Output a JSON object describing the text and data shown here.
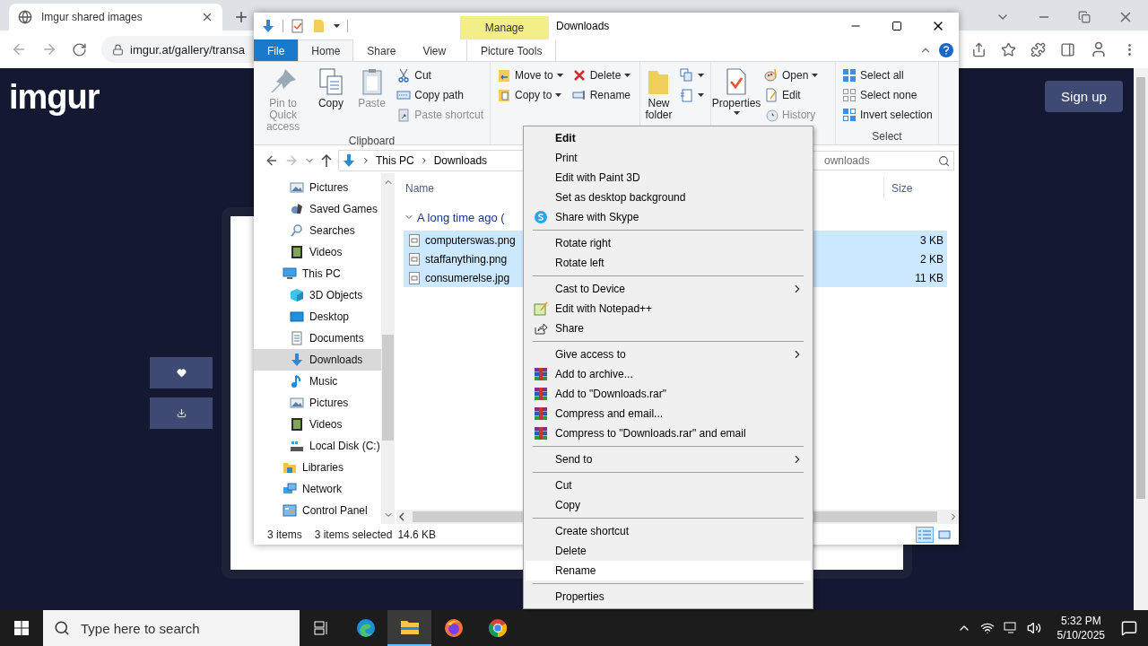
{
  "browser": {
    "tab": {
      "title": "Imgur shared images",
      "selected": true
    },
    "url": "imgur.at/gallery/transa"
  },
  "page": {
    "logo": "imgur",
    "signup": "Sign up"
  },
  "explorer": {
    "title": "Downloads",
    "context_tab": "Manage",
    "tabs": [
      {
        "label": "File",
        "kind": "file",
        "selected": false
      },
      {
        "label": "Home",
        "kind": "plain",
        "selected": true
      },
      {
        "label": "Share",
        "kind": "plain",
        "selected": false
      },
      {
        "label": "View",
        "kind": "plain",
        "selected": false
      },
      {
        "label": "Picture Tools",
        "kind": "context",
        "selected": false
      }
    ],
    "ribbon": [
      {
        "label": "Clipboard",
        "columns": [
          {
            "kind": "large",
            "buttons": [
              {
                "kind": "pin",
                "label": "Pin to Quick access",
                "disabled": true,
                "dropdown": false
              }
            ]
          },
          {
            "kind": "large",
            "buttons": [
              {
                "kind": "copy",
                "label": "Copy",
                "disabled": false,
                "dropdown": false
              }
            ]
          },
          {
            "kind": "large",
            "buttons": [
              {
                "kind": "paste",
                "label": "Paste",
                "disabled": true,
                "dropdown": false
              }
            ]
          },
          {
            "kind": "small",
            "buttons": [
              {
                "kind": "cut",
                "label": "Cut",
                "disabled": false,
                "dropdown": false
              },
              {
                "kind": "copypath",
                "label": "Copy path",
                "disabled": false,
                "dropdown": false
              },
              {
                "kind": "pasteshortcut",
                "label": "Paste shortcut",
                "disabled": true,
                "dropdown": false
              }
            ]
          }
        ]
      },
      {
        "columns": [
          {
            "kind": "small",
            "buttons": [
              {
                "kind": "moveto",
                "label": "Move to",
                "disabled": false,
                "dropdown": true
              },
              {
                "kind": "copyto",
                "label": "Copy to",
                "disabled": false,
                "dropdown": true
              }
            ]
          },
          {
            "kind": "small",
            "buttons": [
              {
                "kind": "delete",
                "label": "Delete",
                "disabled": false,
                "dropdown": true
              },
              {
                "kind": "rename",
                "label": "Rename",
                "disabled": false,
                "dropdown": false
              }
            ]
          }
        ]
      },
      {
        "columns": [
          {
            "kind": "large",
            "buttons": [
              {
                "kind": "newfolder",
                "label": "New folder",
                "disabled": false,
                "dropdown": false
              }
            ]
          },
          {
            "kind": "small",
            "buttons": [
              {
                "kind": "newitem",
                "dropdown": true
              },
              {
                "kind": "easyaccess",
                "dropdown": true
              }
            ]
          }
        ]
      },
      {
        "columns": [
          {
            "kind": "large",
            "buttons": [
              {
                "kind": "properties",
                "label": "Properties",
                "disabled": false,
                "dropdown": true
              }
            ]
          },
          {
            "kind": "small",
            "buttons": [
              {
                "kind": "open",
                "label": "Open",
                "disabled": false,
                "dropdown": true
              },
              {
                "kind": "edit",
                "label": "Edit",
                "disabled": false,
                "dropdown": false
              },
              {
                "kind": "history",
                "label": "History",
                "disabled": true,
                "dropdown": false
              }
            ]
          }
        ]
      },
      {
        "label": "Select",
        "columns": [
          {
            "kind": "small",
            "buttons": [
              {
                "kind": "selectall",
                "label": "Select all",
                "disabled": false,
                "dropdown": false
              },
              {
                "kind": "selectnone",
                "label": "Select none",
                "disabled": false,
                "dropdown": false
              },
              {
                "kind": "invert",
                "label": "Invert selection",
                "disabled": false,
                "dropdown": false
              }
            ]
          }
        ]
      }
    ],
    "breadcrumb": [
      "This PC",
      "Downloads"
    ],
    "search": {
      "placeholder": "ownloads"
    },
    "sidebar": {
      "partial_children": [
        {
          "label": "Pictures",
          "kind": "pictures",
          "selected": false
        },
        {
          "label": "Saved Games",
          "kind": "games",
          "selected": false
        },
        {
          "label": "Searches",
          "kind": "search",
          "selected": false
        },
        {
          "label": "Videos",
          "kind": "videos",
          "selected": false
        }
      ],
      "items": [
        {
          "label": "This PC",
          "kind": "pc",
          "selected": false,
          "children": [
            {
              "label": "3D Objects",
              "kind": "objects",
              "selected": false
            },
            {
              "label": "Desktop",
              "kind": "desktop",
              "selected": false
            },
            {
              "label": "Documents",
              "kind": "documents",
              "selected": false
            },
            {
              "label": "Downloads",
              "kind": "downloads",
              "selected": true
            },
            {
              "label": "Music",
              "kind": "music",
              "selected": false
            },
            {
              "label": "Pictures",
              "kind": "pictures",
              "selected": false
            },
            {
              "label": "Videos",
              "kind": "videos",
              "selected": false
            },
            {
              "label": "Local Disk (C:)",
              "kind": "disk",
              "selected": false
            }
          ]
        },
        {
          "label": "Libraries",
          "kind": "libraries",
          "selected": false
        },
        {
          "label": "Network",
          "kind": "network",
          "selected": false
        },
        {
          "label": "Control Panel",
          "kind": "control",
          "selected": false
        }
      ]
    },
    "columns": [
      "Name",
      "Size"
    ],
    "group": "A long time ago (",
    "files": [
      {
        "name": "computerswas.png",
        "size": "3 KB",
        "selected": true
      },
      {
        "name": "staffanything.png",
        "size": "2 KB",
        "selected": true
      },
      {
        "name": "consumerelse.jpg",
        "size": "11 KB",
        "selected": true
      }
    ],
    "status": {
      "count": "3 items",
      "selected": "3 items selected",
      "size": "14.6 KB"
    }
  },
  "context_menu": [
    [
      {
        "label": "Edit",
        "kind": "plain",
        "default": true,
        "selected": false,
        "submenu": false
      },
      {
        "label": "Print",
        "kind": "plain",
        "default": false,
        "selected": false,
        "submenu": false
      },
      {
        "label": "Edit with Paint 3D",
        "kind": "plain",
        "default": false,
        "selected": false,
        "submenu": false
      },
      {
        "label": "Set as desktop background",
        "kind": "plain",
        "default": false,
        "selected": false,
        "submenu": false
      },
      {
        "label": "Share with Skype",
        "kind": "skype",
        "default": false,
        "selected": false,
        "submenu": false
      }
    ],
    [
      {
        "label": "Rotate right",
        "kind": "plain",
        "default": false,
        "selected": false,
        "submenu": false
      },
      {
        "label": "Rotate left",
        "kind": "plain",
        "default": false,
        "selected": false,
        "submenu": false
      }
    ],
    [
      {
        "label": "Cast to Device",
        "kind": "plain",
        "default": false,
        "selected": false,
        "submenu": true
      },
      {
        "label": "Edit with Notepad++",
        "kind": "notepad",
        "default": false,
        "selected": false,
        "submenu": false
      },
      {
        "label": "Share",
        "kind": "share",
        "default": false,
        "selected": false,
        "submenu": false
      }
    ],
    [
      {
        "label": "Give access to",
        "kind": "plain",
        "default": false,
        "selected": false,
        "submenu": true
      },
      {
        "label": "Add to archive...",
        "kind": "archive",
        "default": false,
        "selected": false,
        "submenu": false
      },
      {
        "label": "Add to \"Downloads.rar\"",
        "kind": "archive",
        "default": false,
        "selected": false,
        "submenu": false
      },
      {
        "label": "Compress and email...",
        "kind": "archive",
        "default": false,
        "selected": false,
        "submenu": false
      },
      {
        "label": "Compress to \"Downloads.rar\" and email",
        "kind": "archive",
        "default": false,
        "selected": false,
        "submenu": false
      }
    ],
    [
      {
        "label": "Send to",
        "kind": "plain",
        "default": false,
        "selected": false,
        "submenu": true
      }
    ],
    [
      {
        "label": "Cut",
        "kind": "plain",
        "default": false,
        "selected": false,
        "submenu": false
      },
      {
        "label": "Copy",
        "kind": "plain",
        "default": false,
        "selected": false,
        "submenu": false
      }
    ],
    [
      {
        "label": "Create shortcut",
        "kind": "plain",
        "default": false,
        "selected": false,
        "submenu": false
      },
      {
        "label": "Delete",
        "kind": "plain",
        "default": false,
        "selected": false,
        "submenu": false
      },
      {
        "label": "Rename",
        "kind": "plain",
        "default": false,
        "selected": true,
        "submenu": false
      }
    ],
    [
      {
        "label": "Properties",
        "kind": "plain",
        "default": false,
        "selected": false,
        "submenu": false
      }
    ]
  ],
  "taskbar": {
    "search_placeholder": "Type here to search",
    "apps": [
      {
        "kind": "taskview",
        "active": false
      },
      {
        "kind": "edge",
        "active": false
      },
      {
        "kind": "explorer",
        "active": true
      },
      {
        "kind": "firefox",
        "active": false
      },
      {
        "kind": "chrome",
        "active": false
      }
    ],
    "time": "5:32 PM",
    "date": "5/10/2025"
  }
}
